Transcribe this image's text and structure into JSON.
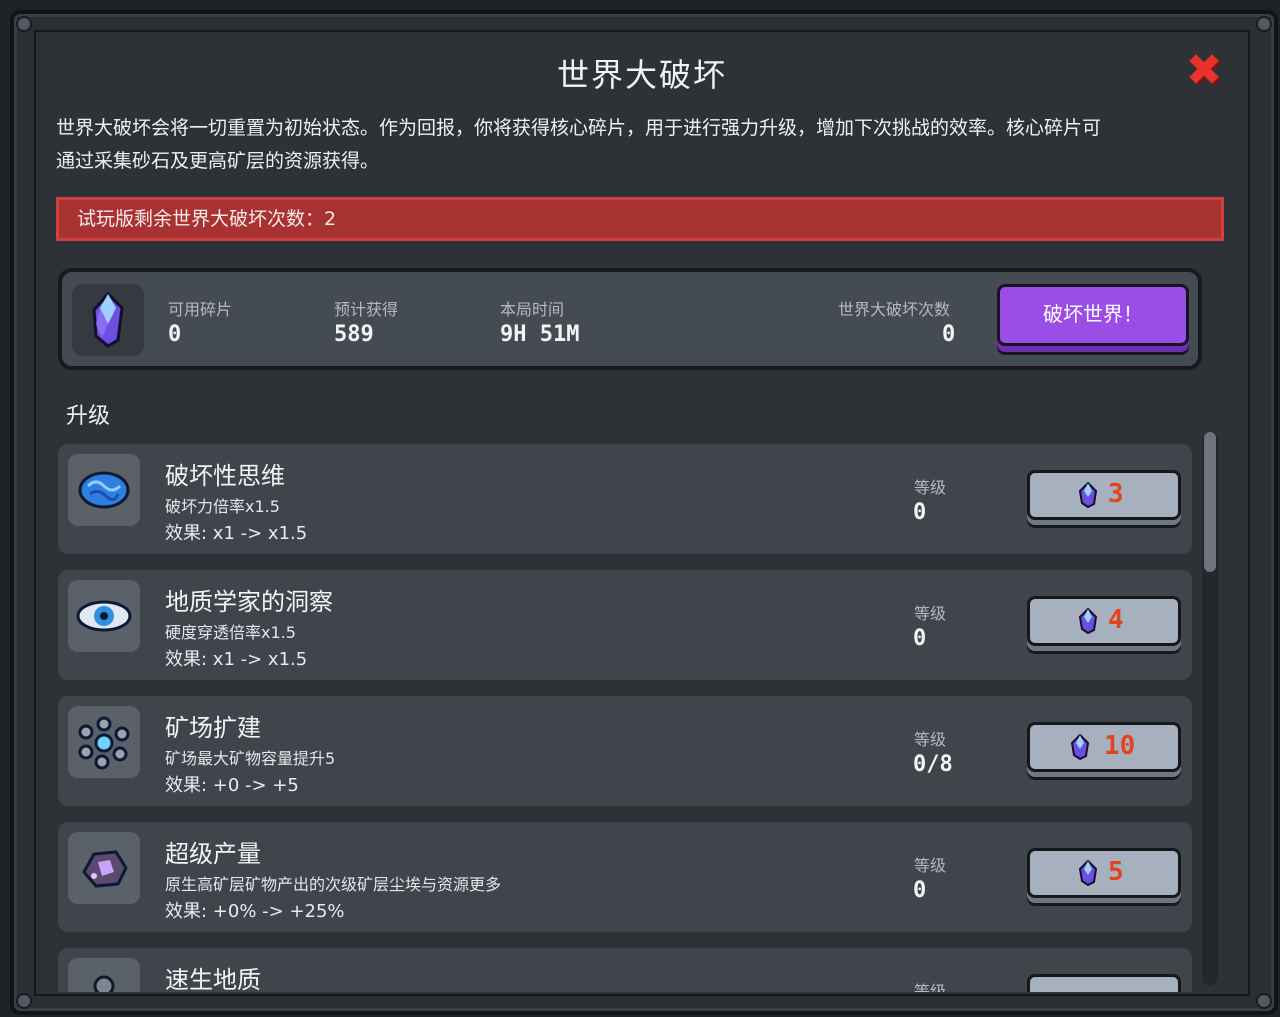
{
  "window": {
    "title": "世界大破坏",
    "close_icon": "close-x-icon",
    "description_line1": "世界大破坏会将一切重置为初始状态。作为回报，你将获得核心碎片，用于进行强力升级，增加下次挑战的效率。核心碎片可",
    "description_line2": "通过采集砂石及更高矿层的资源获得。",
    "warning": "试玩版剩余世界大破坏次数：2"
  },
  "stats": {
    "icon": "core-crystal-icon",
    "available_label": "可用碎片",
    "available_value": "0",
    "expected_label": "预计获得",
    "expected_value": "589",
    "time_label": "本局时间",
    "time_value": "9H 51M",
    "count_label": "世界大破坏次数",
    "count_value": "0",
    "destroy_button": "破坏世界！"
  },
  "upgrades": {
    "section_title": "升级",
    "items": [
      {
        "name": "破坏性思维",
        "desc": "破坏力倍率x1.5",
        "effect": "效果: x1 -> x1.5",
        "level_label": "等级",
        "level": "0",
        "cost": "3",
        "icon": "brain-icon"
      },
      {
        "name": "地质学家的洞察",
        "desc": "硬度穿透倍率x1.5",
        "effect": "效果: x1 -> x1.5",
        "level_label": "等级",
        "level": "0",
        "cost": "4",
        "icon": "eye-icon"
      },
      {
        "name": "矿场扩建",
        "desc": "矿场最大矿物容量提升5",
        "effect": "效果: +0 -> +5",
        "level_label": "等级",
        "level": "0/8",
        "cost": "10",
        "icon": "ore-cluster-icon"
      },
      {
        "name": "超级产量",
        "desc": "原生高矿层矿物产出的次级矿层尘埃与资源更多",
        "effect": "效果: +0% -> +25%",
        "level_label": "等级",
        "level": "0",
        "cost": "5",
        "icon": "rock-gem-icon"
      },
      {
        "name": "速生地质",
        "desc": "",
        "effect": "",
        "level_label": "等级",
        "level": "",
        "cost": "",
        "icon": "sprout-icon"
      }
    ]
  },
  "colors": {
    "warning_bg": "#a83232",
    "destroy_button": "#9b4ee6",
    "cost_text": "#e0451f",
    "close_icon": "#e8322c"
  }
}
